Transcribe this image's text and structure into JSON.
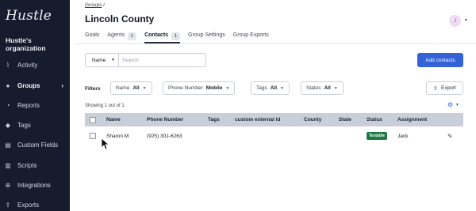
{
  "app": {
    "logo": "Hustle",
    "org_name": "Hustle's organization"
  },
  "sidebar": {
    "items": [
      {
        "label": "Activity",
        "icon": "activity-icon",
        "glyph": "⌇"
      },
      {
        "label": "Groups",
        "icon": "groups-icon",
        "glyph": "●",
        "active": true,
        "chevron": "›"
      },
      {
        "label": "Reports",
        "icon": "reports-icon",
        "glyph": "◔"
      },
      {
        "label": "Tags",
        "icon": "tag-icon",
        "glyph": "◆"
      },
      {
        "label": "Custom Fields",
        "icon": "custom-fields-icon",
        "glyph": "▤"
      },
      {
        "label": "Scripts",
        "icon": "scripts-icon",
        "glyph": "▥"
      },
      {
        "label": "Integrations",
        "icon": "integrations-icon",
        "glyph": "⊕"
      },
      {
        "label": "Exports",
        "icon": "exports-icon",
        "glyph": "⇪"
      }
    ]
  },
  "header": {
    "breadcrumb_link": "Groups",
    "breadcrumb_sep": "/",
    "title": "Lincoln County",
    "avatar_initial": "J",
    "avatar_chevron": "▾"
  },
  "tabs": [
    {
      "label": "Goals"
    },
    {
      "label": "Agents",
      "badge": "1"
    },
    {
      "label": "Contacts",
      "badge": "1",
      "active": true
    },
    {
      "label": "Group Settings"
    },
    {
      "label": "Group Exports"
    }
  ],
  "search": {
    "field_select": "Name",
    "placeholder": "Search",
    "value": ""
  },
  "actions": {
    "add_contacts": "Add contacts",
    "export": "Export"
  },
  "filters": {
    "label": "Filters",
    "items": [
      {
        "name": "Name",
        "value": "All"
      },
      {
        "name": "Phone Number",
        "value": "Mobile"
      },
      {
        "name": "Tags",
        "value": "All"
      },
      {
        "name": "Status",
        "value": "All"
      }
    ]
  },
  "showing": "Showing 1 out of 1",
  "table": {
    "columns": [
      "Name",
      "Phone Number",
      "Tags",
      "custom external id",
      "County",
      "State",
      "Status",
      "Assignment"
    ],
    "rows": [
      {
        "name": "Sharon M",
        "phone": "(925) 301-6263",
        "tags": "",
        "external_id": "",
        "county": "",
        "state": "",
        "status": "Textable",
        "assignment": "Jack"
      }
    ]
  },
  "colors": {
    "sidebar_bg": "#161b2e",
    "accent": "#3363d6",
    "status_textable": "#1d7a45",
    "table_header": "#c9ceda"
  }
}
